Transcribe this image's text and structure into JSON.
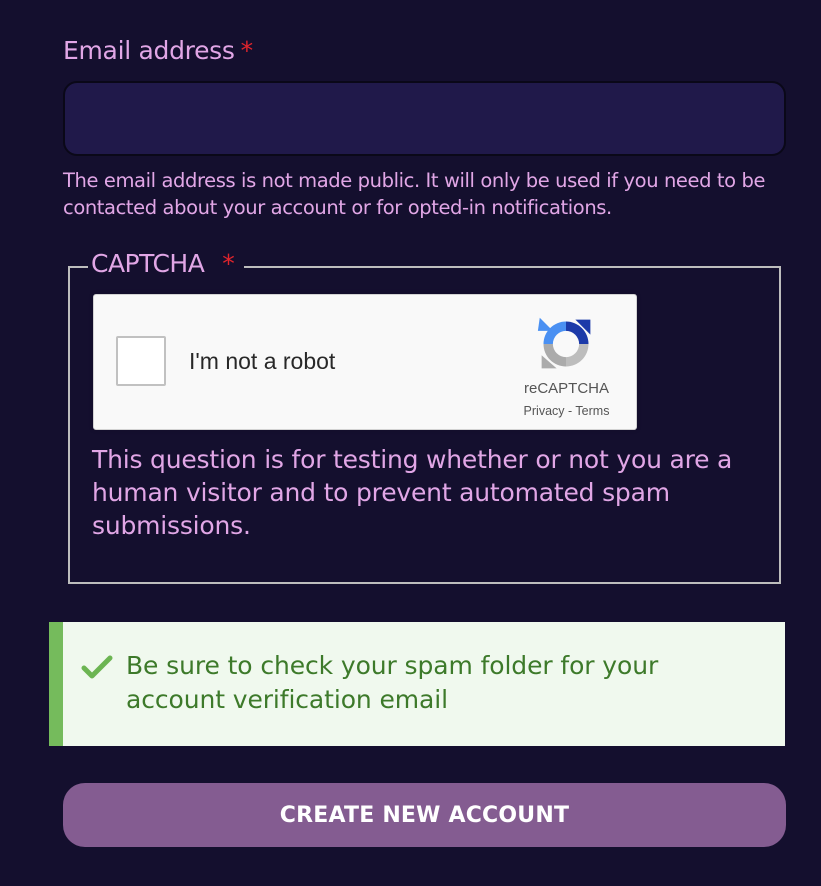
{
  "email": {
    "label": "Email address",
    "required_marker": "*",
    "value": "",
    "placeholder": "",
    "help": "The email address is not made public. It will only be used if you need to be contacted about your account or for opted-in notifications."
  },
  "captcha": {
    "legend": "CAPTCHA",
    "required_marker": "*",
    "checkbox_label": "I'm not a robot",
    "checked": false,
    "brand": "reCAPTCHA",
    "privacy_link": "Privacy",
    "separator": " - ",
    "terms_link": "Terms",
    "help": "This question is for testing whether or not you are a human visitor and to prevent automated spam submissions."
  },
  "notice": {
    "icon": "checkmark-icon",
    "text": "Be sure to check your spam folder for your account verification email"
  },
  "submit": {
    "label": "CREATE NEW ACCOUNT"
  },
  "colors": {
    "page_bg": "#140f2e",
    "label_text": "#e1a6e6",
    "required": "#e0242c",
    "input_bg": "#20194a",
    "notice_bg": "#f0f9ee",
    "notice_accent": "#75bb5c",
    "notice_text": "#3d7a2a",
    "button_bg": "#845c91",
    "button_text": "#ffffff"
  }
}
